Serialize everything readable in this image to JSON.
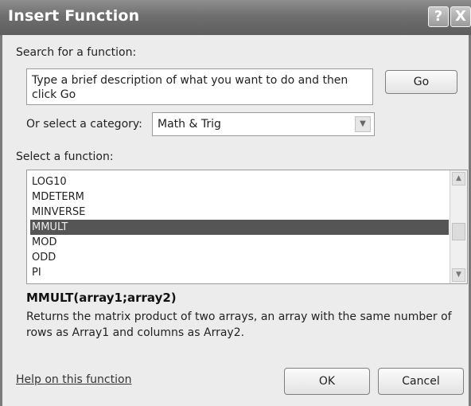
{
  "window": {
    "title": "Insert Function",
    "help_glyph": "?",
    "close_glyph": "X"
  },
  "search": {
    "label": "Search for a function:",
    "description": "Type a brief description of what you want to do and then click Go",
    "go_label": "Go"
  },
  "category": {
    "label": "Or select a category:",
    "selected": "Math & Trig",
    "arrow_glyph": "▼"
  },
  "functions": {
    "label": "Select a function:",
    "items": [
      "LOG10",
      "MDETERM",
      "MINVERSE",
      "MMULT",
      "MOD",
      "ODD",
      "PI"
    ],
    "selected_index": 3,
    "scroll_up_glyph": "▲",
    "scroll_down_glyph": "▼"
  },
  "details": {
    "syntax": "MMULT(array1;array2)",
    "description": "Returns the matrix product of two arrays, an array with the same number of rows as Array1 and columns as Array2."
  },
  "footer": {
    "help_link": "Help on this function",
    "ok_label": "OK",
    "cancel_label": "Cancel"
  }
}
